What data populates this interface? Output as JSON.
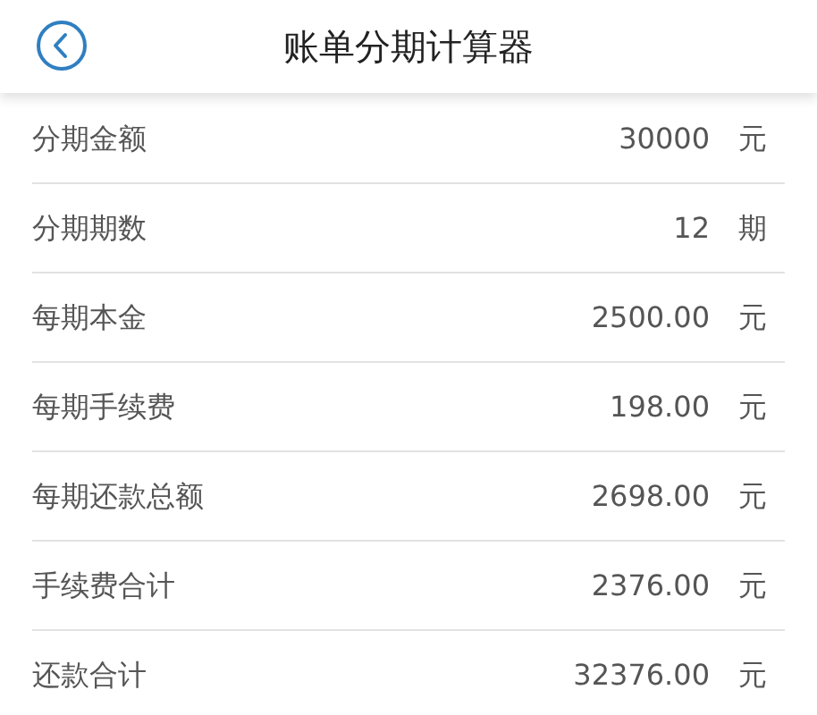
{
  "header": {
    "title": "账单分期计算器"
  },
  "rows": [
    {
      "label": "分期金额",
      "value": "30000",
      "unit": "元"
    },
    {
      "label": "分期期数",
      "value": "12",
      "unit": "期"
    },
    {
      "label": "每期本金",
      "value": "2500.00",
      "unit": "元"
    },
    {
      "label": "每期手续费",
      "value": "198.00",
      "unit": "元"
    },
    {
      "label": "每期还款总额",
      "value": "2698.00",
      "unit": "元"
    },
    {
      "label": "手续费合计",
      "value": "2376.00",
      "unit": "元"
    },
    {
      "label": "还款合计",
      "value": "32376.00",
      "unit": "元"
    }
  ]
}
